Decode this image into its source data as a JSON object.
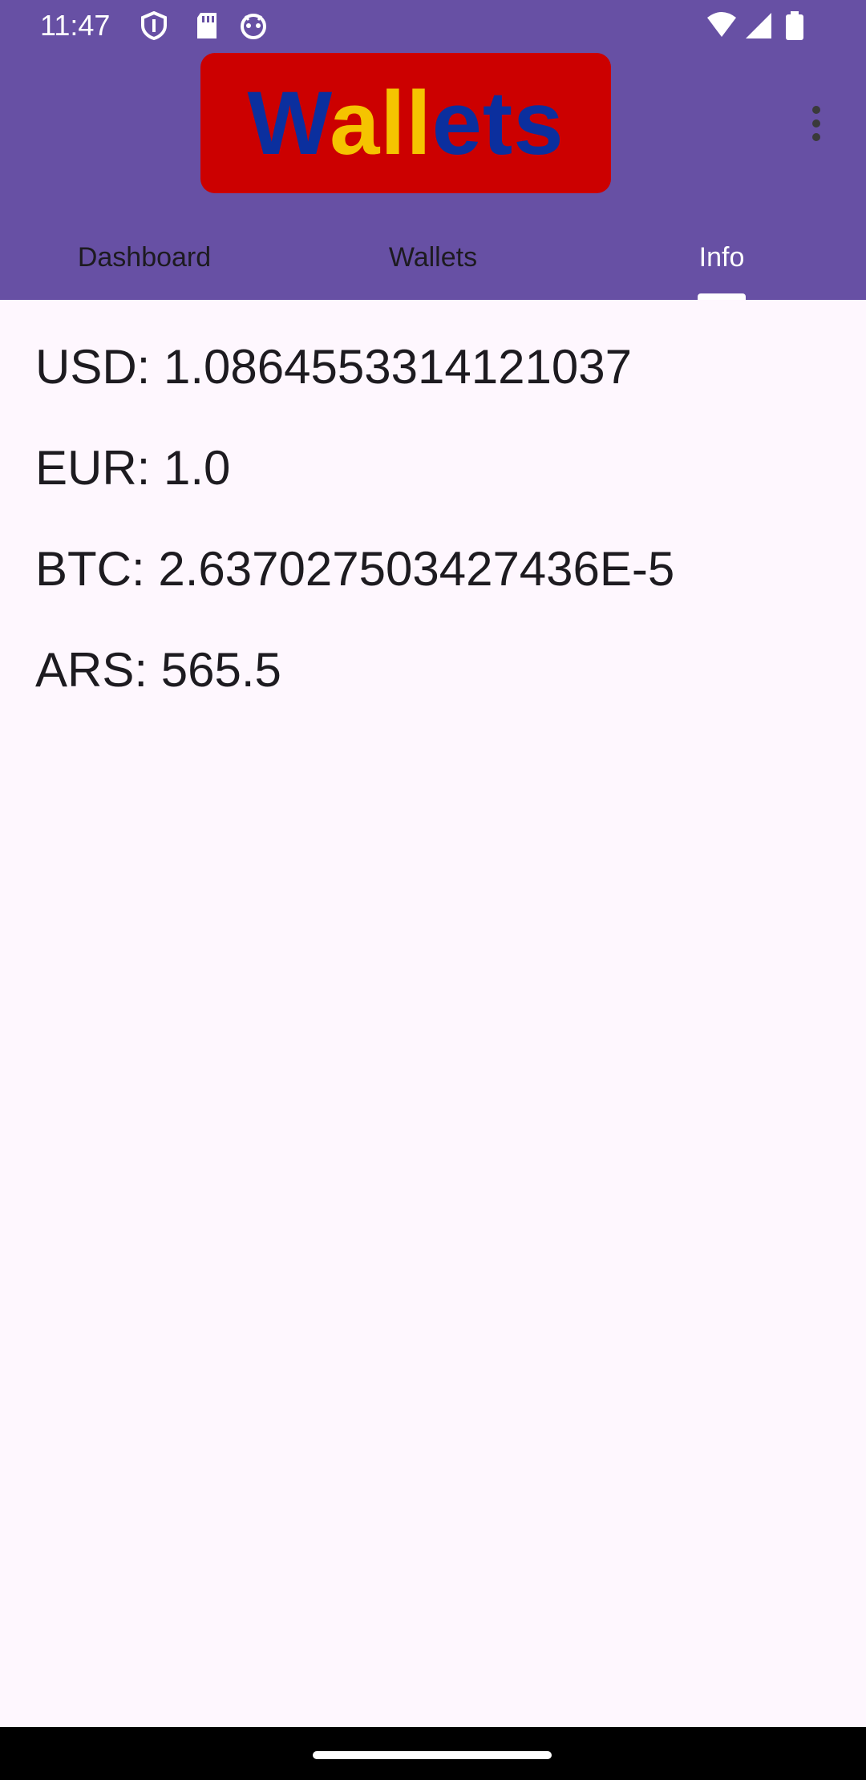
{
  "status_bar": {
    "time": "11:47",
    "left_icons": [
      "shield-icon",
      "sd-card-icon",
      "android-icon"
    ],
    "right_icons": [
      "wifi-icon",
      "signal-icon",
      "battery-icon"
    ]
  },
  "app_bar": {
    "logo_text_parts": [
      "W",
      "all",
      "ets"
    ],
    "menu_icon": "more-vert-icon"
  },
  "tabs": [
    {
      "label": "Dashboard",
      "selected": false
    },
    {
      "label": "Wallets",
      "selected": false
    },
    {
      "label": "Info",
      "selected": true
    }
  ],
  "rates": [
    "USD: 1.0864553314121037",
    "EUR: 1.0",
    "BTC: 2.637027503427436E-5",
    "ARS: 565.5"
  ],
  "colors": {
    "header_bg": "#6750A4",
    "logo_bg": "#CC0000",
    "logo_blue": "#0B2F9E",
    "logo_gold": "#F5C400",
    "page_bg": "#FEF7FE"
  }
}
